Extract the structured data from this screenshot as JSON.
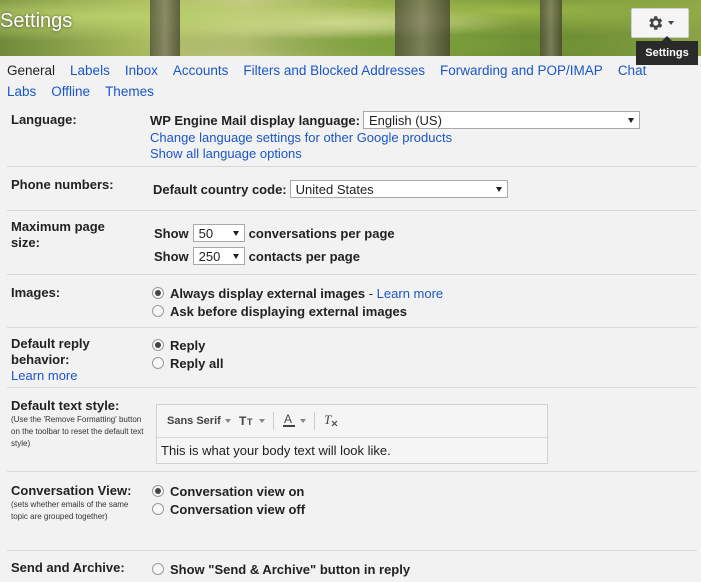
{
  "header": {
    "title": "Settings",
    "gear_tooltip": "Settings"
  },
  "tabs": {
    "row1": [
      "General",
      "Labels",
      "Inbox",
      "Accounts",
      "Filters and Blocked Addresses",
      "Forwarding and POP/IMAP",
      "Chat"
    ],
    "row2": [
      "Labs",
      "Offline",
      "Themes"
    ],
    "active": "General"
  },
  "language": {
    "label": "Language:",
    "text": "WP Engine Mail display language:",
    "value": "English (US)",
    "link1": "Change language settings for other Google products",
    "link2": "Show all language options"
  },
  "phone": {
    "label": "Phone numbers:",
    "text": "Default country code:",
    "value": "United States"
  },
  "page_size": {
    "label1": "Maximum page",
    "label2": "size:",
    "show": "Show",
    "conv_value": "50",
    "conv_text": "conversations per page",
    "contacts_value": "250",
    "contacts_text": "contacts per page"
  },
  "images": {
    "label": "Images:",
    "opt1": "Always display external images",
    "dash": " - ",
    "learn": "Learn more",
    "opt2": "Ask before displaying external images"
  },
  "reply": {
    "label1": "Default reply",
    "label2": "behavior:",
    "learn": "Learn more",
    "opt1": "Reply",
    "opt2": "Reply all"
  },
  "text_style": {
    "label": "Default text style:",
    "note": "(Use the 'Remove Formatting' button on the toolbar to reset the default text style)",
    "font": "Sans Serif",
    "preview": "This is what your body text will look like."
  },
  "conversation": {
    "label": "Conversation View:",
    "note": "(sets whether emails of the same topic are grouped together)",
    "opt1": "Conversation view on",
    "opt2": "Conversation view off"
  },
  "send_archive": {
    "label": "Send and Archive:",
    "opt1": "Show \"Send & Archive\" button in reply"
  }
}
